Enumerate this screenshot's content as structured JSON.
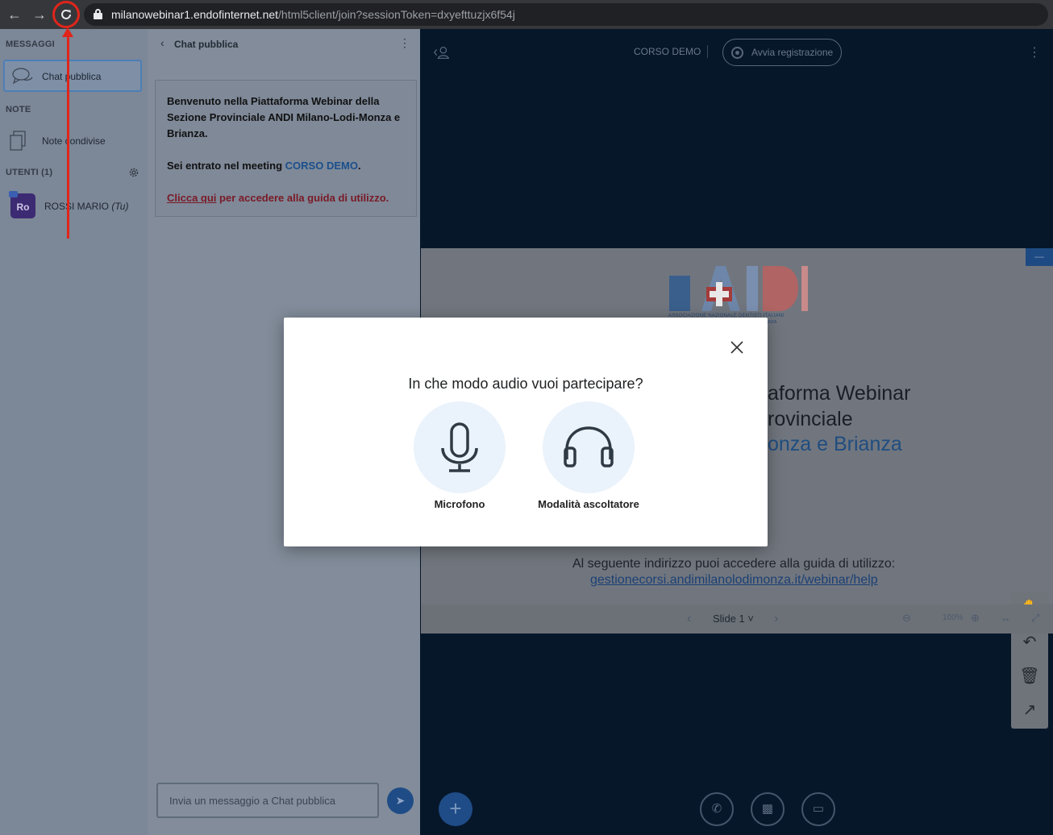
{
  "browser": {
    "url_host": "milanowebinar1.endofinternet.net",
    "url_path": "/html5client/join?sessionToken=dxyefttuzjx6f54j"
  },
  "sidebar": {
    "messages_heading": "MESSAGGI",
    "public_chat_label": "Chat pubblica",
    "notes_heading": "NOTE",
    "shared_notes_label": "Note condivise",
    "users_heading": "UTENTI (1)",
    "user": {
      "avatar_initials": "Ro",
      "name": "ROSSI MARIO",
      "you_tag": "(Tu)"
    }
  },
  "chat": {
    "header_title": "Chat pubblica",
    "welcome_line1": "Benvenuto nella Piattaforma Webinar della Sezione Provinciale ANDI Milano-Lodi-Monza e Brianza.",
    "welcome_meeting_prefix": "Sei entrato nel meeting ",
    "welcome_meeting_name": "CORSO DEMO",
    "welcome_meeting_suffix": ".",
    "guide_link_text": "Clicca qui",
    "guide_suffix": " per accedere alla guida di utilizzo.",
    "input_placeholder": "Invia un messaggio a Chat pubblica"
  },
  "main": {
    "meeting_title": "CORSO DEMO",
    "record_label": "Avvia registrazione",
    "slide": {
      "line1": "aforma Webinar",
      "line2": "rovinciale",
      "line3": "onza e Brianza",
      "logo_caption": "ASSOCIAZIONE NAZIONALE DENTISTI ITALIANI",
      "logo_caption2": "ONZA E BRIANZA",
      "guide_text": "Al seguente indirizzo puoi accedere alla guida di utilizzo:",
      "guide_url": "gestionecorsi.andimilanolodimonza.it/webinar/help"
    },
    "slide_nav": {
      "slide_label": "Slide 1",
      "zoom": "100%"
    }
  },
  "modal": {
    "title": "In che modo audio vuoi partecipare?",
    "option_mic": "Microfono",
    "option_listen": "Modalità ascoltatore"
  },
  "colors": {
    "accent_blue": "#1f4c86",
    "annotation_red": "#e0251b",
    "modal_option_bg": "#eaf2fb"
  }
}
